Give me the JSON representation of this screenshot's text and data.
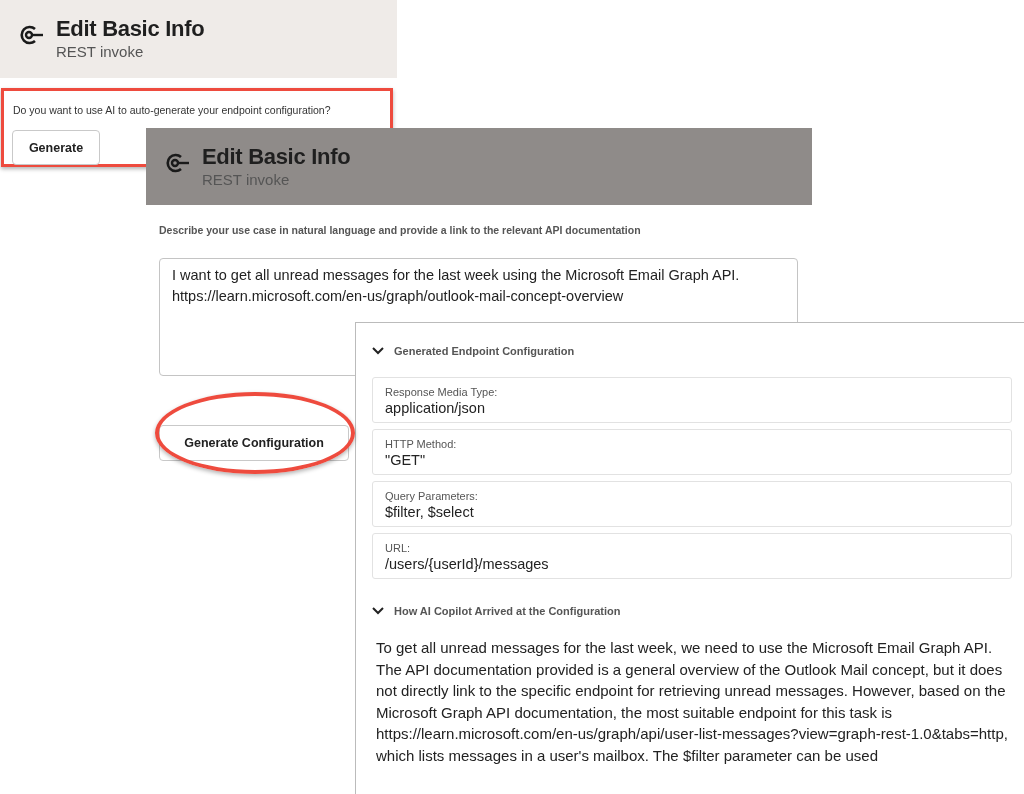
{
  "first_dialog": {
    "header": {
      "title": "Edit Basic Info",
      "subtitle": "REST invoke"
    },
    "question": "Do you want to use AI to auto-generate your endpoint configuration?",
    "button": "Generate"
  },
  "second_dialog": {
    "header": {
      "title": "Edit Basic Info",
      "subtitle": "REST invoke"
    },
    "instruction": "Describe your use case in natural language and provide a link to the relevant API documentation",
    "use_case": "I want to get all unread messages for the last week using the Microsoft Email Graph API.\nhttps://learn.microsoft.com/en-us/graph/outlook-mail-concept-overview",
    "button": "Generate Configuration"
  },
  "result_panel": {
    "sections": [
      {
        "title": "Generated Endpoint Configuration",
        "expanded": true,
        "fields": [
          {
            "label": "Response Media Type:",
            "value": "application/json"
          },
          {
            "label": "HTTP Method:",
            "value": "\"GET\""
          },
          {
            "label": "Query Parameters:",
            "value": "$filter, $select"
          },
          {
            "label": "URL:",
            "value": "/users/{userId}/messages"
          }
        ]
      },
      {
        "title": "How AI Copilot Arrived at the Configuration",
        "expanded": true,
        "text": "To get all unread messages for the last week, we need to use the Microsoft Email Graph API. The API documentation provided is a general overview of the Outlook Mail concept, but it does not directly link to the specific endpoint for retrieving unread messages. However, based on the Microsoft Graph API documentation, the most suitable endpoint for this task is https://learn.microsoft.com/en-us/graph/api/user-list-messages?view=graph-rest-1.0&tabs=http, which lists messages in a user's mailbox. The $filter parameter can be used"
      }
    ]
  }
}
